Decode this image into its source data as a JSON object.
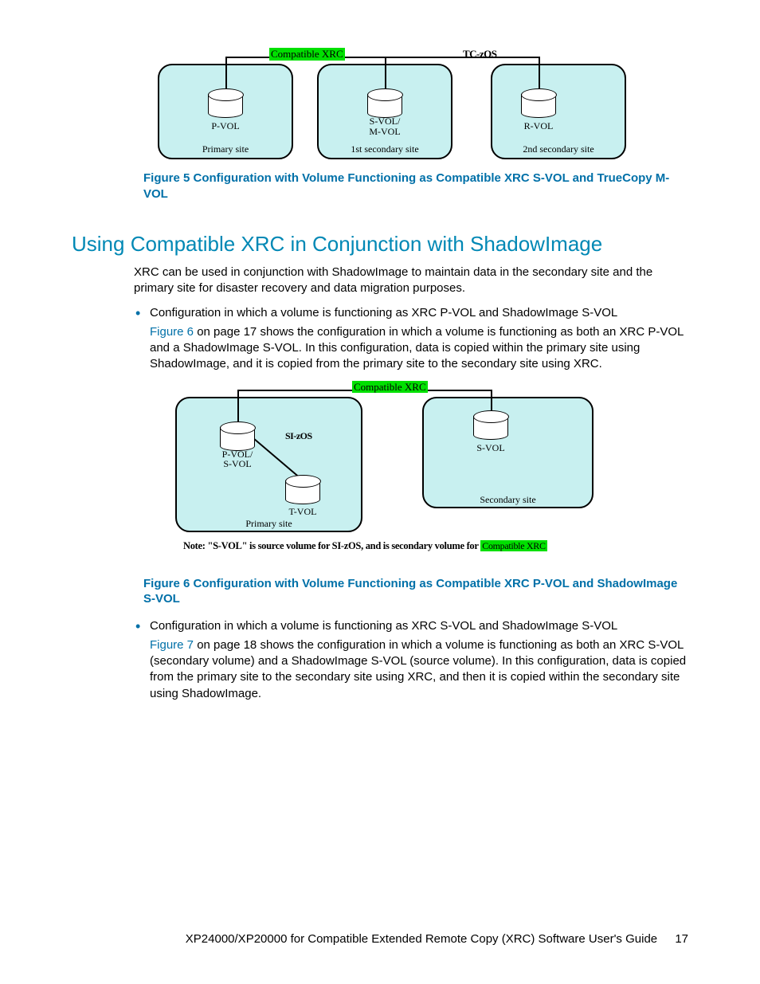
{
  "figure5": {
    "tag_xrc": "Compatible XRC",
    "tag_tc": "TC-zOS",
    "pvol": "P-VOL",
    "svol_mvol": "S-VOL/\nM-VOL",
    "rvol": "R-VOL",
    "primary": "Primary site",
    "sec1": "1st secondary site",
    "sec2": "2nd secondary site",
    "caption": "Figure 5 Configuration with Volume Functioning as Compatible XRC S-VOL and TrueCopy M-VOL"
  },
  "heading": "Using Compatible XRC in Conjunction with ShadowImage",
  "intro": "XRC can be used in conjunction with ShadowImage to maintain data in the secondary site and the primary site for disaster recovery and data migration purposes.",
  "bullet1": "Configuration in which a volume is functioning as XRC P-VOL and ShadowImage S-VOL",
  "sub1_link": "Figure 6",
  "sub1_rest": " on page 17 shows the configuration in which a volume is functioning as both an XRC P-VOL and a ShadowImage S-VOL. In this configuration, data is copied within the primary site using ShadowImage, and it is copied from the primary site to the secondary site using XRC.",
  "figure6": {
    "tag_xrc": "Compatible XRC",
    "si_zos": "SI-zOS",
    "pvol_svol": "P-VOL/\nS-VOL",
    "tvol": "T-VOL",
    "svol": "S-VOL",
    "primary": "Primary site",
    "secondary": "Secondary site",
    "note_part1": "Note: \"S-VOL\" is source volume for SI-zOS, and is secondary volume for ",
    "note_xrc": "Compatible XRC",
    "caption": "Figure 6 Configuration with Volume Functioning as Compatible XRC P-VOL and ShadowImage S-VOL"
  },
  "bullet2": "Configuration in which a volume is functioning as XRC S-VOL and ShadowImage S-VOL",
  "sub2_link": "Figure 7",
  "sub2_rest": " on page 18 shows the configuration in which a volume is functioning as both an XRC S-VOL (secondary volume) and a ShadowImage S-VOL (source volume). In this configuration, data is copied from the primary site to the secondary site using XRC, and then it is copied within the secondary site using ShadowImage.",
  "footer_text": "XP24000/XP20000 for Compatible Extended Remote Copy (XRC) Software User's Guide",
  "page_number": "17"
}
